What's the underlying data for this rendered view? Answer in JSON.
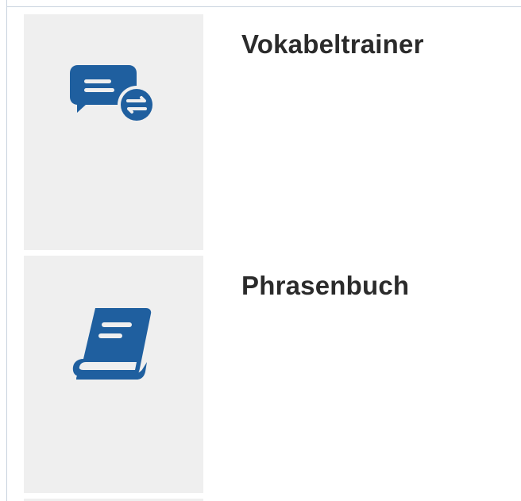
{
  "cards": [
    {
      "title": "Vokabeltrainer",
      "icon": "vocabulary-trainer-icon"
    },
    {
      "title": "Phrasenbuch",
      "icon": "phrasebook-icon"
    }
  ],
  "colors": {
    "accent": "#1f5f9f",
    "tile_background": "#efefef",
    "title_text": "#2b2b2b",
    "border": "#c9d3df"
  }
}
